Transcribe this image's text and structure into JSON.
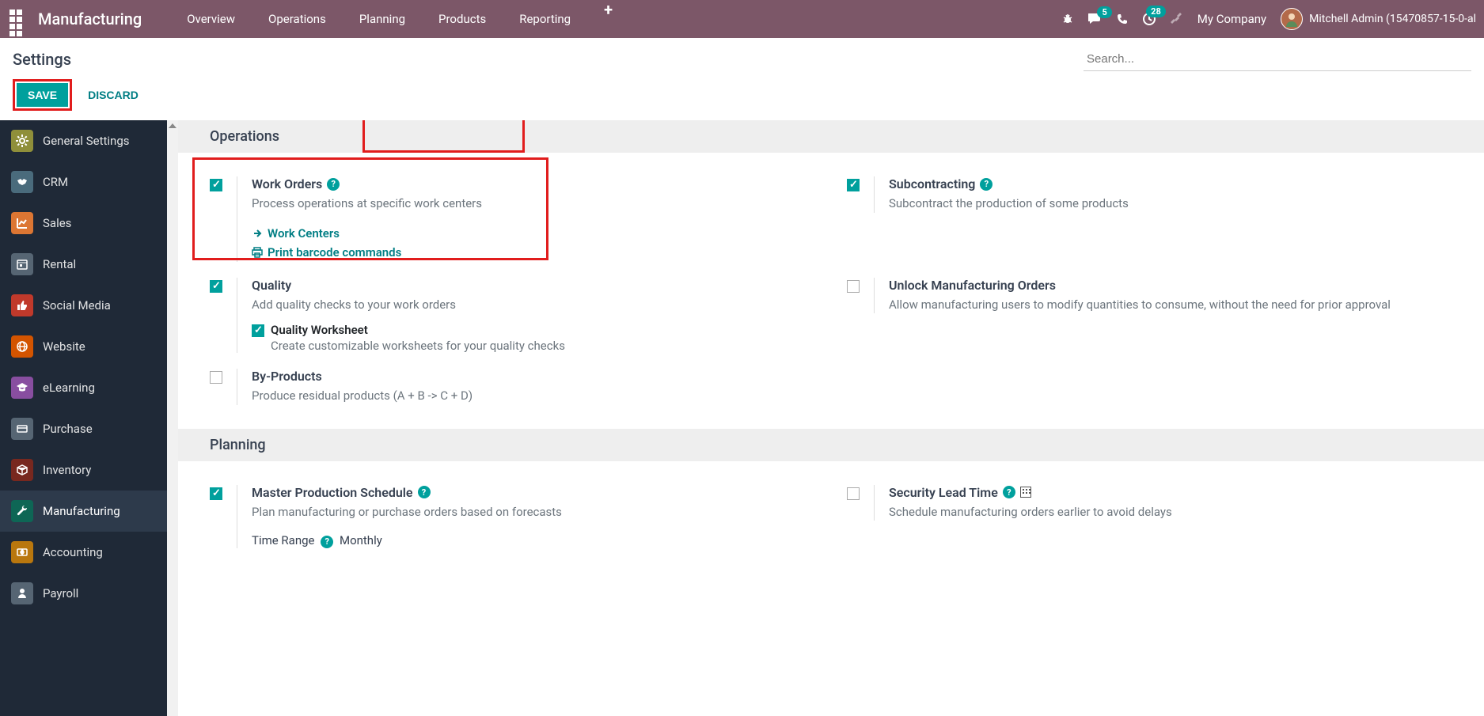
{
  "topnav": {
    "brand": "Manufacturing",
    "items": [
      "Overview",
      "Operations",
      "Planning",
      "Products",
      "Reporting"
    ],
    "badges": {
      "messages": "5",
      "activities": "28"
    },
    "company": "My Company",
    "user": "Mitchell Admin (15470857-15-0-al"
  },
  "control": {
    "title": "Settings",
    "save": "SAVE",
    "discard": "DISCARD",
    "search_placeholder": "Search..."
  },
  "sidebar": {
    "items": [
      {
        "label": "General Settings",
        "color": "#8F8F3A",
        "icon": "gear"
      },
      {
        "label": "CRM",
        "color": "#4A6B7C",
        "icon": "handshake"
      },
      {
        "label": "Sales",
        "color": "#DC7633",
        "icon": "chart"
      },
      {
        "label": "Rental",
        "color": "#566573",
        "icon": "calendar"
      },
      {
        "label": "Social Media",
        "color": "#C0392B",
        "icon": "thumb"
      },
      {
        "label": "Website",
        "color": "#D35400",
        "icon": "globe"
      },
      {
        "label": "eLearning",
        "color": "#884EA0",
        "icon": "grad"
      },
      {
        "label": "Purchase",
        "color": "#566573",
        "icon": "card"
      },
      {
        "label": "Inventory",
        "color": "#78281F",
        "icon": "box"
      },
      {
        "label": "Manufacturing",
        "color": "#0E6655",
        "icon": "wrench",
        "active": true
      },
      {
        "label": "Accounting",
        "color": "#B9770E",
        "icon": "money"
      },
      {
        "label": "Payroll",
        "color": "#566573",
        "icon": "person"
      }
    ]
  },
  "sections": {
    "operations": {
      "title": "Operations",
      "settings": [
        {
          "id": "work_orders",
          "checked": true,
          "title": "Work Orders",
          "desc": "Process operations at specific work centers",
          "help": true,
          "links": [
            {
              "icon": "arrow",
              "label": "Work Centers"
            },
            {
              "icon": "print",
              "label": "Print barcode commands"
            }
          ]
        },
        {
          "id": "subcontracting",
          "checked": true,
          "title": "Subcontracting",
          "desc": "Subcontract the production of some products",
          "help": true
        },
        {
          "id": "quality",
          "checked": true,
          "title": "Quality",
          "desc": "Add quality checks to your work orders",
          "sub": {
            "checked": true,
            "title": "Quality Worksheet",
            "desc": "Create customizable worksheets for your quality checks"
          }
        },
        {
          "id": "unlock_mo",
          "checked": false,
          "title": "Unlock Manufacturing Orders",
          "desc": "Allow manufacturing users to modify quantities to consume, without the need for prior approval"
        },
        {
          "id": "byproducts",
          "checked": false,
          "title": "By-Products",
          "desc": "Produce residual products (A + B -> C + D)"
        }
      ]
    },
    "planning": {
      "title": "Planning",
      "settings": [
        {
          "id": "mps",
          "checked": true,
          "title": "Master Production Schedule",
          "desc": "Plan manufacturing or purchase orders based on forecasts",
          "help": true,
          "extra_label": "Time Range",
          "extra_value": "Monthly"
        },
        {
          "id": "sec_lead",
          "checked": false,
          "title": "Security Lead Time",
          "desc": "Schedule manufacturing orders earlier to avoid delays",
          "help": true,
          "building": true
        }
      ]
    }
  }
}
